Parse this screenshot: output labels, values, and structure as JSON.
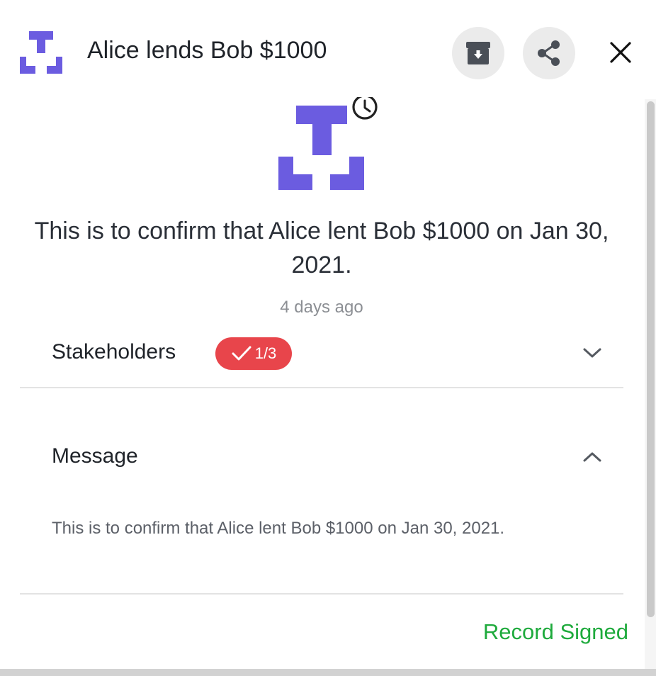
{
  "header": {
    "title": "Alice lends Bob $1000",
    "archive_icon": "archive-box-icon",
    "share_icon": "share-icon",
    "close_icon": "close-icon"
  },
  "record": {
    "logo_icon": "record-logo-icon",
    "pending_icon": "clock-icon",
    "confirmation": "This is to confirm that Alice lent Bob $1000 on Jan 30, 2021.",
    "time_ago": "4 days ago"
  },
  "stakeholders": {
    "label": "Stakeholders",
    "badge_text": "1/3",
    "badge_icon": "checkmark-icon",
    "chevron_icon": "chevron-down-icon"
  },
  "message": {
    "label": "Message",
    "body": "This is to confirm that Alice lent Bob $1000 on Jan 30, 2021.",
    "chevron_icon": "chevron-up-icon"
  },
  "footer": {
    "status": "Record Signed"
  },
  "colors": {
    "brand": "#6b5ce0",
    "badge": "#e8454b",
    "status": "#1eaa3c"
  }
}
